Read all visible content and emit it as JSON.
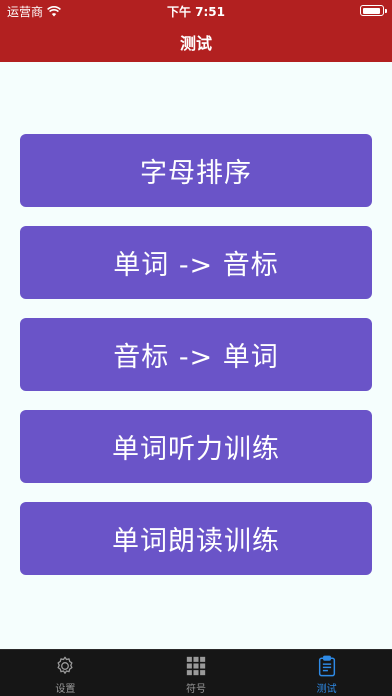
{
  "status_bar": {
    "carrier": "运营商",
    "time": "下午 7:51",
    "battery_level": 0.95
  },
  "nav": {
    "title": "测试"
  },
  "menu": {
    "items": [
      {
        "label": "字母排序"
      },
      {
        "label": "单词 -> 音标"
      },
      {
        "label": "音标 -> 单词"
      },
      {
        "label": "单词听力训练"
      },
      {
        "label": "单词朗读训练"
      }
    ]
  },
  "tabbar": {
    "tabs": [
      {
        "label": "设置",
        "icon": "gear-icon",
        "active": false
      },
      {
        "label": "符号",
        "icon": "grid-icon",
        "active": false
      },
      {
        "label": "测试",
        "icon": "clipboard-icon",
        "active": true
      }
    ]
  },
  "colors": {
    "header_bg": "#b22020",
    "button_bg": "#6a54c8",
    "page_bg": "#f5fefd",
    "tabbar_bg": "#161616",
    "tab_active": "#2e8ae6",
    "tab_inactive": "#9a9a9a"
  }
}
